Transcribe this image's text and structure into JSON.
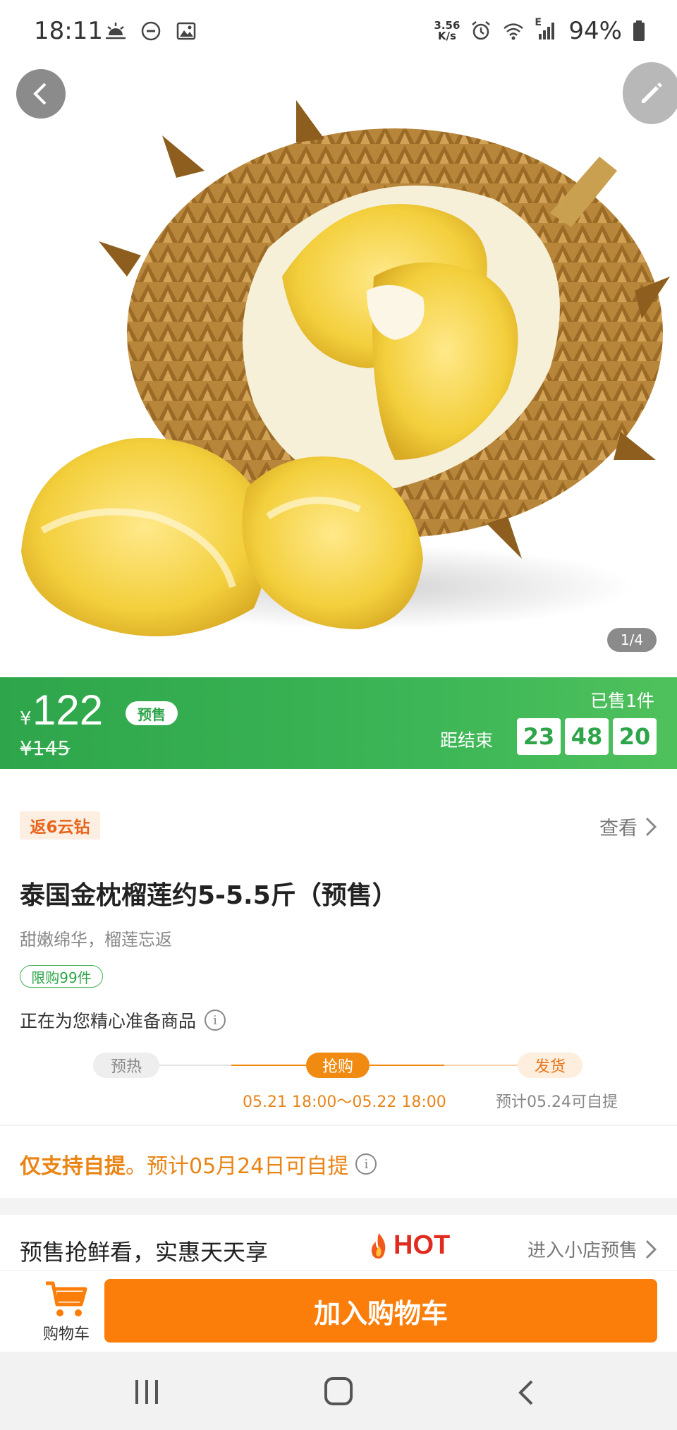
{
  "status_bar": {
    "time": "18:11",
    "speed_value": "3.56",
    "speed_unit": "K/s",
    "network": "E",
    "battery": "94%"
  },
  "gallery": {
    "page_indicator": "1/4"
  },
  "price": {
    "currency": "¥",
    "current": "122",
    "presale_tag": "预售",
    "original": "¥145",
    "sold": "已售1件",
    "countdown_label": "距结束",
    "countdown": [
      "23",
      "48",
      "20"
    ]
  },
  "reward": {
    "tag": "返6云钻",
    "view_link": "查看"
  },
  "product": {
    "title": "泰国金枕榴莲约5-5.5斤（预售）",
    "subtitle": "甜嫩绵华，榴莲忘返",
    "limit": "限购99件",
    "preparing": "正在为您精心准备商品"
  },
  "steps": {
    "preheat": "预热",
    "buy": "抢购",
    "ship": "发货",
    "buy_time": "05.21 18:00～05.22 18:00",
    "ship_time": "预计05.24可自提"
  },
  "pickup": {
    "strong": "仅支持自提",
    "rest": "。预计05月24日可自提"
  },
  "promo": {
    "title": "预售抢鲜看，实惠天天享",
    "hot": "HOT",
    "shop_link": "进入小店预售"
  },
  "action_bar": {
    "cart_label": "购物车",
    "add_to_cart": "加入购物车"
  },
  "colors": {
    "green": "#2ea54a",
    "orange": "#fb7d0a",
    "hot_red": "#e02b1f"
  }
}
